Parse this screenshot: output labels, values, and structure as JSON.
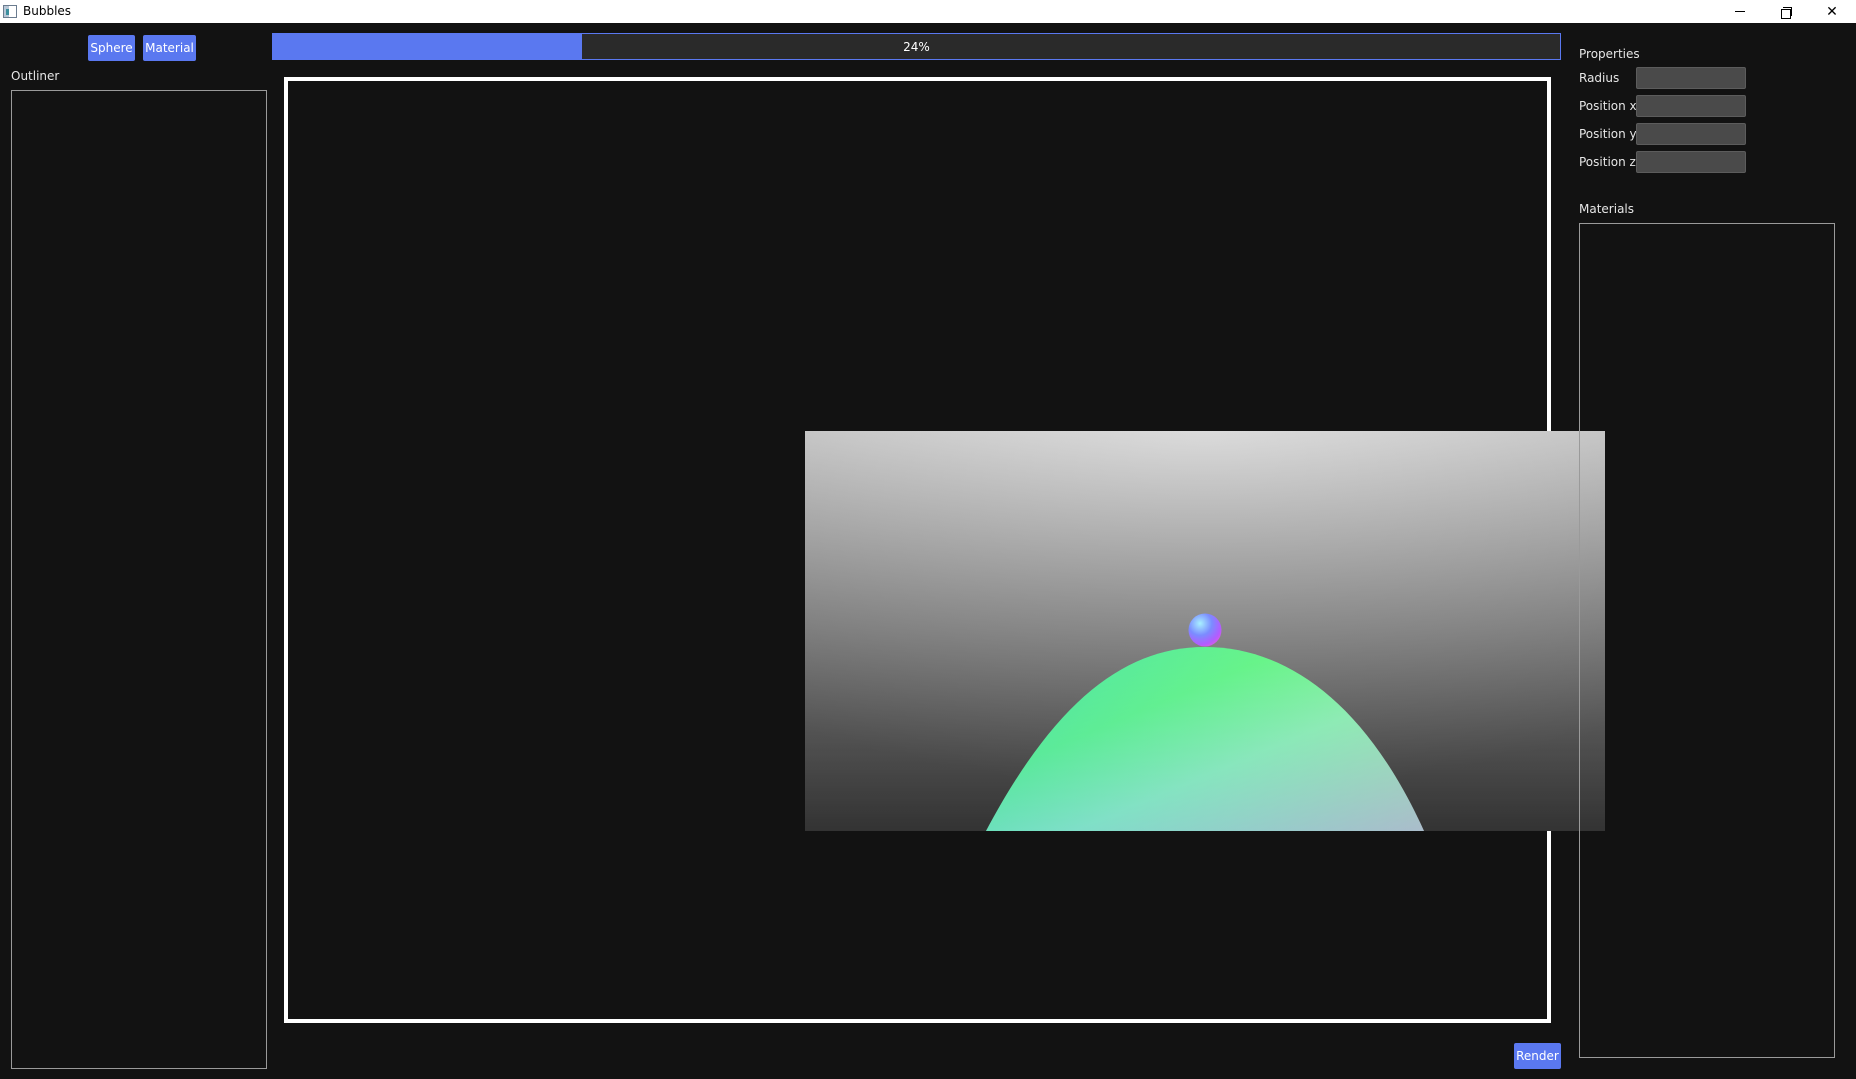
{
  "window": {
    "title": "Bubbles",
    "controls": {
      "minimize_icon": "minimize-icon",
      "restore_icon": "restore-icon",
      "close_icon": "close-icon",
      "close_glyph": "✕"
    }
  },
  "toolbar": {
    "sphere_label": "Sphere",
    "material_label": "Material",
    "render_label": "Render"
  },
  "progress": {
    "value": 0.24,
    "text": "24%"
  },
  "outliner": {
    "label": "Outliner",
    "items": []
  },
  "properties": {
    "label": "Properties",
    "fields": [
      {
        "label": "Radius",
        "value": ""
      },
      {
        "label": "Position x",
        "value": ""
      },
      {
        "label": "Position y",
        "value": ""
      },
      {
        "label": "Position z",
        "value": ""
      }
    ]
  },
  "materials": {
    "label": "Materials",
    "items": []
  },
  "colors": {
    "accent": "#5a78f0",
    "background": "#121212",
    "panel_border": "#9a9a9a",
    "input_bg": "#4a4a4a"
  },
  "render_preview": {
    "description_icon": "rendered-scene-image"
  }
}
